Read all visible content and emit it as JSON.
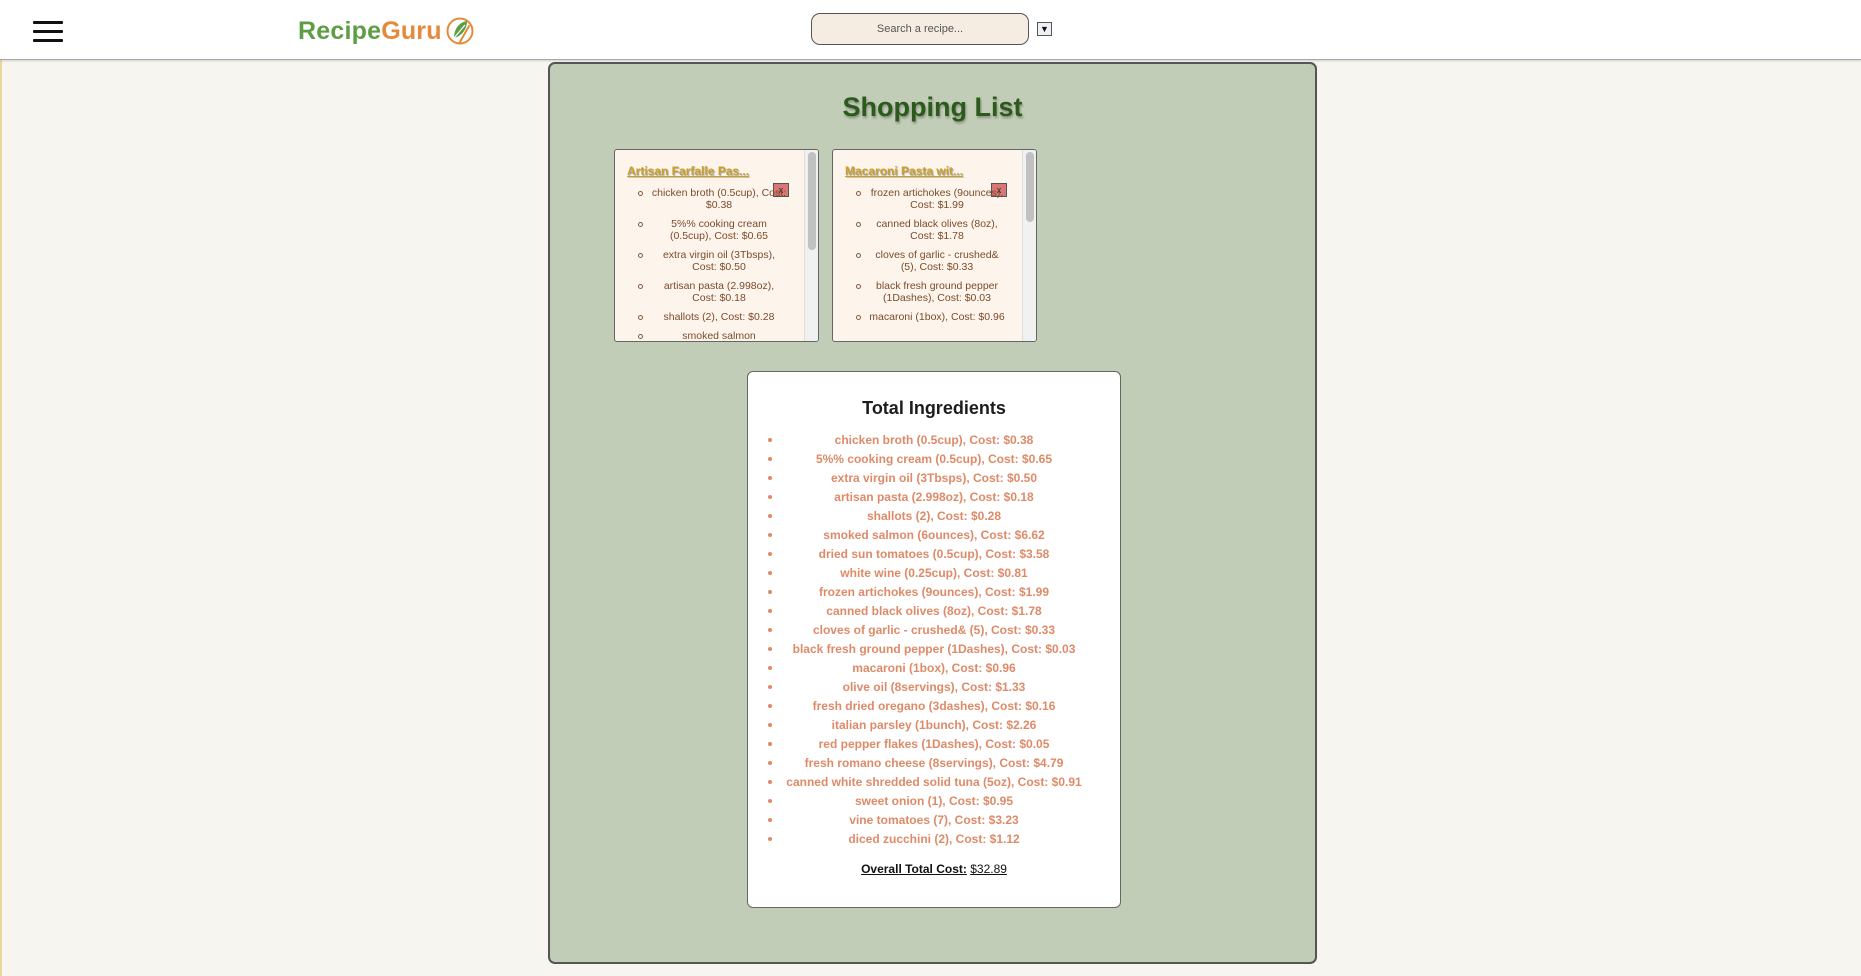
{
  "header": {
    "logo_part1": "Recipe",
    "logo_part2": "Guru",
    "search_placeholder": "Search a recipe...",
    "dropdown_symbol": "▼"
  },
  "page": {
    "title": "Shopping List"
  },
  "recipes": [
    {
      "title": "Artisan Farfalle Pas...",
      "remove_label": "x",
      "ingredients": [
        "chicken broth (0.5cup), Cost: $0.38",
        "5%% cooking cream (0.5cup), Cost: $0.65",
        "extra virgin oil (3Tbsps), Cost: $0.50",
        "artisan pasta (2.998oz), Cost: $0.18",
        "shallots (2), Cost: $0.28",
        "smoked salmon"
      ]
    },
    {
      "title": "Macaroni Pasta wit...",
      "remove_label": "x",
      "ingredients": [
        "frozen artichokes (9ounces), Cost: $1.99",
        "canned black olives (8oz), Cost: $1.78",
        "cloves of garlic - crushed& (5), Cost: $0.33",
        "black fresh ground pepper (1Dashes), Cost: $0.03",
        "macaroni (1box), Cost: $0.96"
      ]
    }
  ],
  "totals": {
    "title": "Total Ingredients",
    "items": [
      "chicken broth (0.5cup), Cost: $0.38",
      "5%% cooking cream (0.5cup), Cost: $0.65",
      "extra virgin oil (3Tbsps), Cost: $0.50",
      "artisan pasta (2.998oz), Cost: $0.18",
      "shallots (2), Cost: $0.28",
      "smoked salmon (6ounces), Cost: $6.62",
      "dried sun tomatoes (0.5cup), Cost: $3.58",
      "white wine (0.25cup), Cost: $0.81",
      "frozen artichokes (9ounces), Cost: $1.99",
      "canned black olives (8oz), Cost: $1.78",
      "cloves of garlic - crushed& (5), Cost: $0.33",
      "black fresh ground pepper (1Dashes), Cost: $0.03",
      "macaroni (1box), Cost: $0.96",
      "olive oil (8servings), Cost: $1.33",
      "fresh dried oregano (3dashes), Cost: $0.16",
      "italian parsley (1bunch), Cost: $2.26",
      "red pepper flakes (1Dashes), Cost: $0.05",
      "fresh romano cheese (8servings), Cost: $4.79",
      "canned white shredded solid tuna (5oz), Cost: $0.91",
      "sweet onion (1), Cost: $0.95",
      "vine tomatoes (7), Cost: $3.23",
      "diced zucchini (2), Cost: $1.12"
    ],
    "overall_label": "Overall Total Cost:",
    "overall_value": "$32.89"
  }
}
